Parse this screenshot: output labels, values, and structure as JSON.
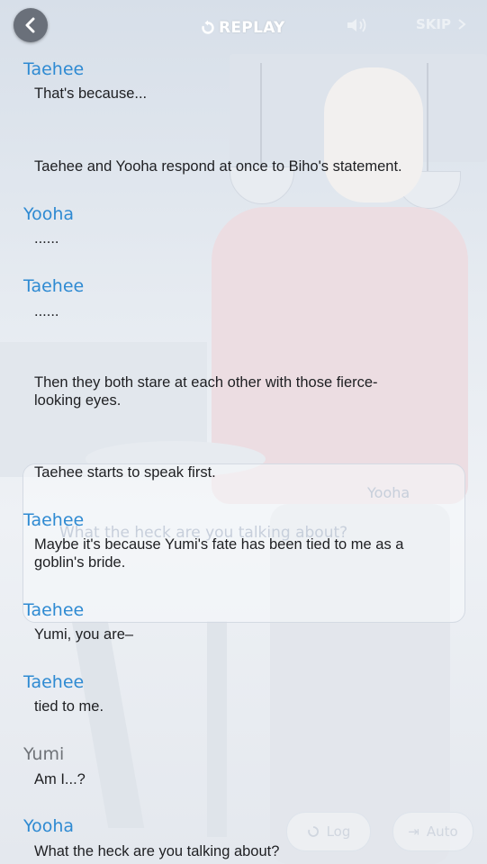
{
  "topbar": {
    "replay_label": "REPLAY",
    "skip_label": "SKIP"
  },
  "background": {
    "ghost_name": "Yooha",
    "ghost_line": "What the heck are you talking about?",
    "log_label": "Log",
    "auto_label": "Auto"
  },
  "log": [
    {
      "speaker": "Taehee",
      "text": "That's because..."
    },
    {
      "speaker": "",
      "text": "Taehee and Yooha respond at once to Biho's statement."
    },
    {
      "speaker": "Yooha",
      "text": "......"
    },
    {
      "speaker": "Taehee",
      "text": "......"
    },
    {
      "speaker": "",
      "text": "Then they both stare at each other with those fierce-looking eyes."
    },
    {
      "speaker": "",
      "text": "Taehee starts to speak first."
    },
    {
      "speaker": "Taehee",
      "text": "Maybe it's because Yumi's fate has been tied to me as a goblin's bride."
    },
    {
      "speaker": "Taehee",
      "text": "Yumi, you are–"
    },
    {
      "speaker": "Taehee",
      "text": "tied to me."
    },
    {
      "speaker": "Yumi",
      "text": "Am I...?"
    },
    {
      "speaker": "Yooha",
      "text": "What the heck are you talking about?"
    }
  ],
  "colors": {
    "speaker_blue": "#2e8ad2",
    "speaker_gray": "#6f7378",
    "text": "#1e1f22"
  }
}
